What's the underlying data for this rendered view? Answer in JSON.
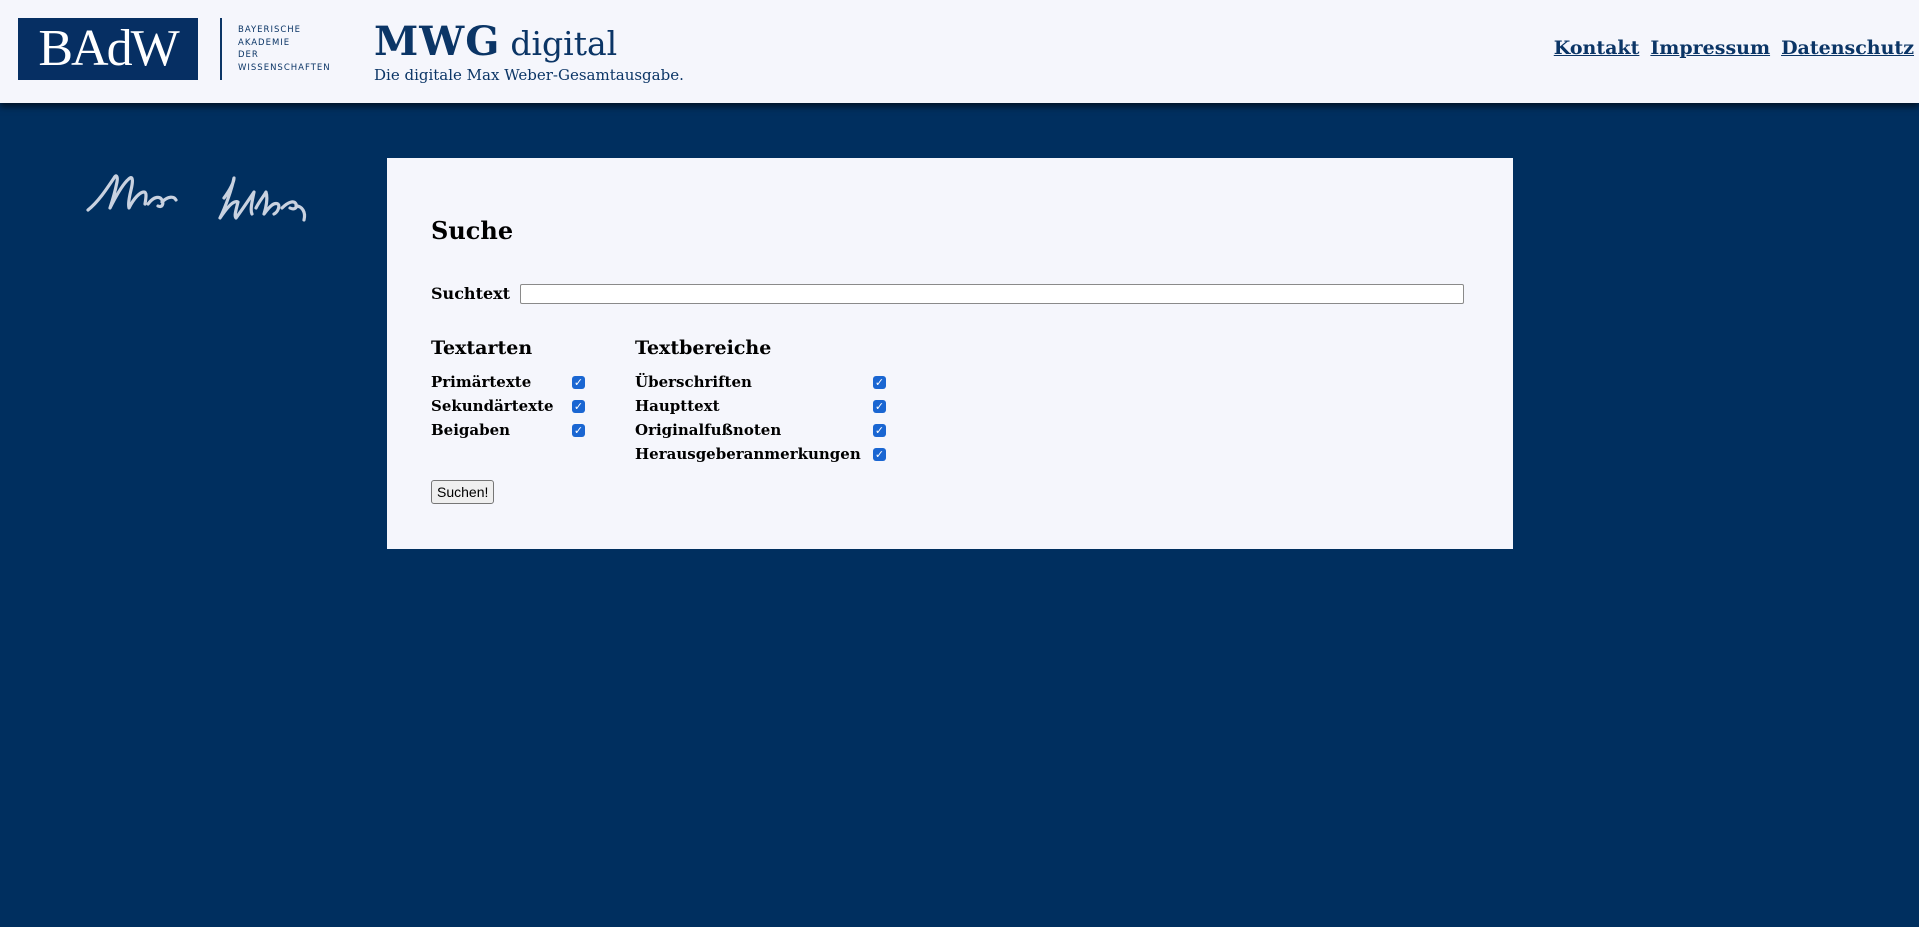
{
  "header": {
    "logo_text": "BAdW",
    "academy_lines": [
      "BAYERISCHE",
      "AKADEMIE",
      "DER",
      "WISSENSCHAFTEN"
    ],
    "title_bold": "MWG",
    "title_light": "digital",
    "subtitle": "Die digitale Max Weber-Gesamtausgabe.",
    "links": [
      "Kontakt",
      "Impressum",
      "Datenschutz"
    ]
  },
  "search": {
    "heading": "Suche",
    "field_label": "Suchtext",
    "field_value": "",
    "submit_label": "Suchen!"
  },
  "textarten": {
    "title": "Textarten",
    "options": [
      {
        "label": "Primärtexte",
        "checked": true
      },
      {
        "label": "Sekundärtexte",
        "checked": true
      },
      {
        "label": "Beigaben",
        "checked": true
      }
    ]
  },
  "textbereiche": {
    "title": "Textbereiche",
    "options": [
      {
        "label": "Überschriften",
        "checked": true
      },
      {
        "label": "Haupttext",
        "checked": true
      },
      {
        "label": "Originalfußnoten",
        "checked": true
      },
      {
        "label": "Herausgeberanmerkungen",
        "checked": true
      }
    ]
  },
  "colors": {
    "page_background": "#002f5f",
    "header_background": "#f5f6fc",
    "brand": "#0b3566",
    "checkbox": "#1a66d2"
  },
  "icons": {
    "checkbox": "checkmark-icon",
    "signature": "max-weber-signature"
  }
}
